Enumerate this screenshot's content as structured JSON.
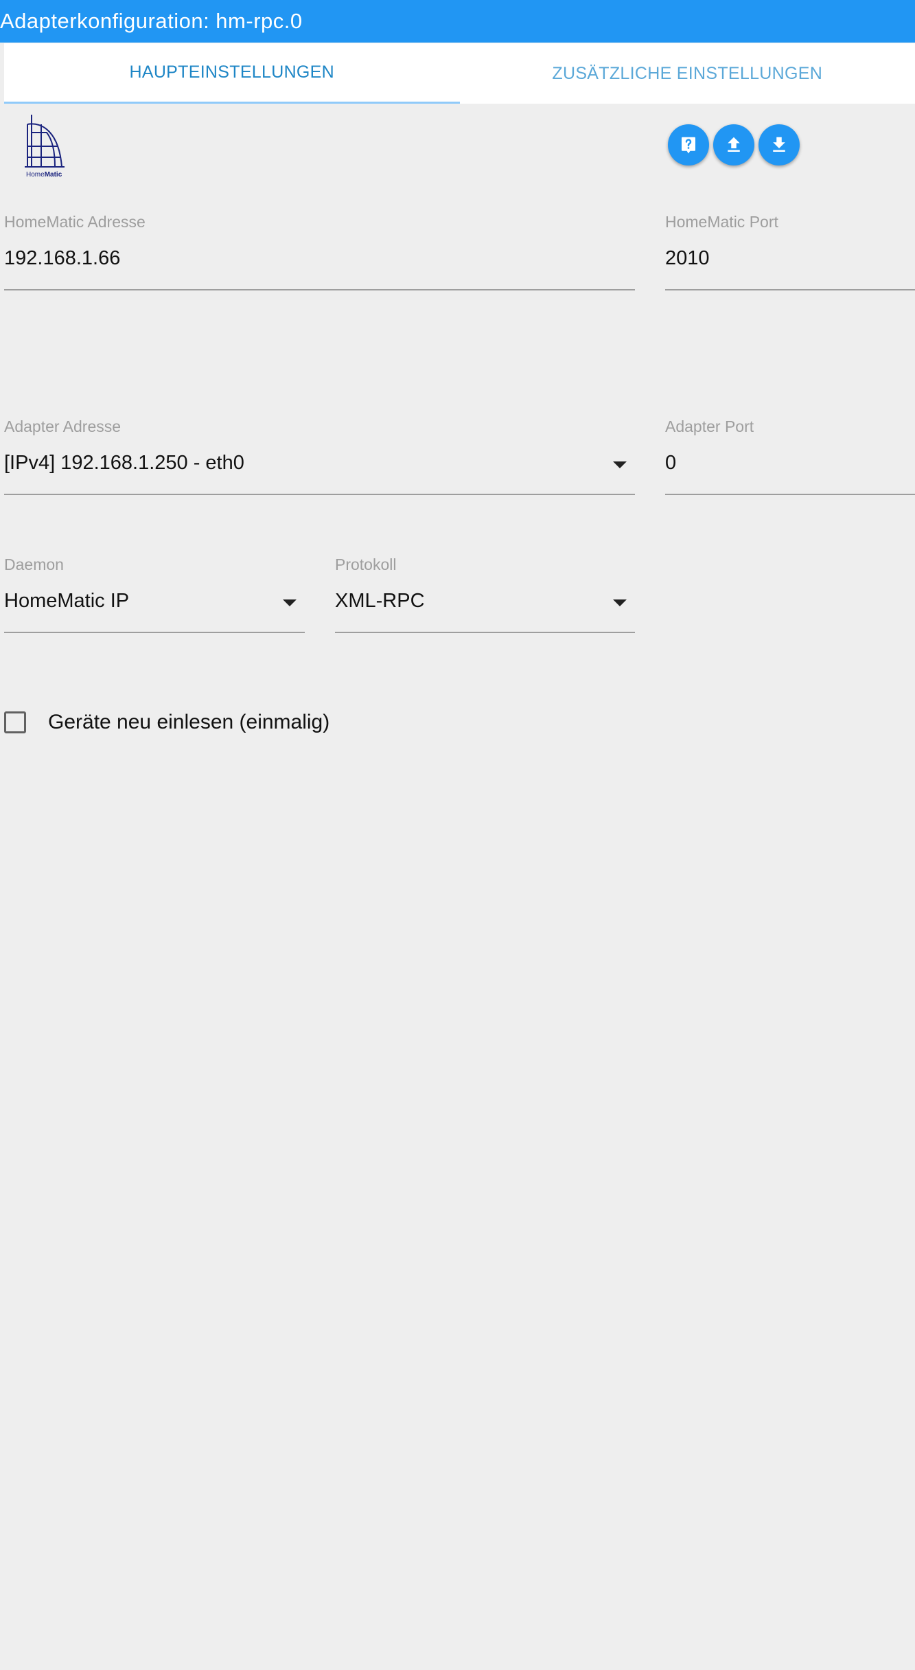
{
  "header": {
    "title": "Adapterkonfiguration: hm-rpc.0"
  },
  "tabs": [
    {
      "label": "HAUPTEINSTELLUNGEN",
      "active": true
    },
    {
      "label": "ZUSÄTZLICHE EINSTELLUNGEN",
      "active": false
    }
  ],
  "logo": {
    "text_home": "Home",
    "text_matic": "Matic",
    "color": "#1a237e"
  },
  "actions": [
    {
      "icon": "help-icon"
    },
    {
      "icon": "upload-icon"
    },
    {
      "icon": "download-icon"
    }
  ],
  "form": {
    "homematic_address": {
      "label": "HomeMatic Adresse",
      "value": "192.168.1.66"
    },
    "homematic_port": {
      "label": "HomeMatic Port",
      "value": "2010"
    },
    "adapter_address": {
      "label": "Adapter Adresse",
      "value": "[IPv4] 192.168.1.250 - eth0"
    },
    "adapter_port": {
      "label": "Adapter Port",
      "value": "0"
    },
    "daemon": {
      "label": "Daemon",
      "value": "HomeMatic IP"
    },
    "protocol": {
      "label": "Protokoll",
      "value": "XML-RPC"
    },
    "reload_devices": {
      "label": "Geräte neu einlesen (einmalig)",
      "checked": false
    }
  },
  "colors": {
    "accent": "#2196f3",
    "background": "#eeeeee",
    "tab_active": "#1e86c6",
    "tab_inactive": "#5ba8d8"
  }
}
